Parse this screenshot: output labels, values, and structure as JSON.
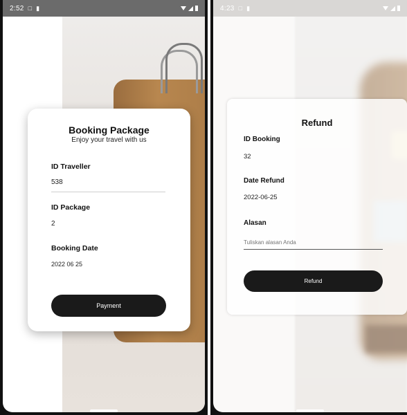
{
  "screen1": {
    "status_time": "2:52",
    "card": {
      "title": "Booking Package",
      "subtitle": "Enjoy your travel with us",
      "traveller_label": "ID Traveller",
      "traveller_value": "538",
      "package_label": "ID Package",
      "package_value": "2",
      "date_label": "Booking Date",
      "date_value": "2022 06 25",
      "button_label": "Payment"
    }
  },
  "screen2": {
    "status_time": "4:23",
    "card": {
      "title": "Refund",
      "booking_label": "ID Booking",
      "booking_value": "32",
      "date_label": "Date Refund",
      "date_value": "2022-06-25",
      "reason_label": "Alasan",
      "reason_placeholder": "Tuliskan alasan Anda",
      "button_label": "Refund"
    }
  }
}
